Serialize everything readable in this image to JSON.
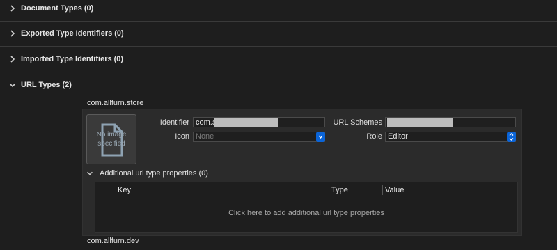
{
  "sections": {
    "document_types": "Document Types (0)",
    "exported_types": "Exported Type Identifiers (0)",
    "imported_types": "Imported Type Identifiers (0)",
    "url_types": "URL Types (2)"
  },
  "url_types": {
    "entries": [
      {
        "title": "com.allfurn.store",
        "image_well_text": "No image specified",
        "identifier_label": "Identifier",
        "identifier_value": "com.a",
        "icon_label": "Icon",
        "icon_value": "None",
        "url_schemes_label": "URL Schemes",
        "role_label": "Role",
        "role_value": "Editor",
        "additional": {
          "title": "Additional url type properties (0)",
          "columns": [
            "Key",
            "Type",
            "Value"
          ],
          "placeholder": "Click here to add additional url type properties"
        }
      },
      {
        "title": "com.allfurn.dev"
      }
    ]
  },
  "colors": {
    "accent": "#0a64d8",
    "background": "#1e1e1e",
    "panel": "#2b2b2b"
  },
  "icons": [
    "chevron-right-icon",
    "chevron-down-icon",
    "document-icon",
    "stepper-icon"
  ]
}
